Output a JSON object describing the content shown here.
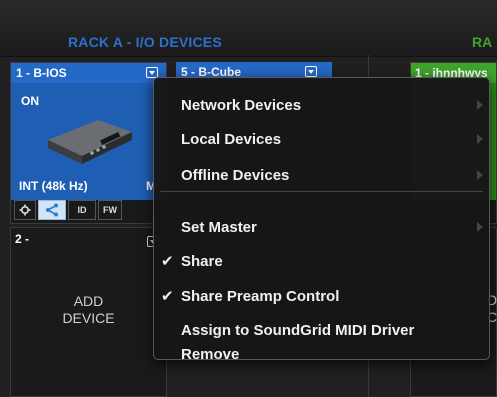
{
  "rack_a": {
    "title": "RACK A - I/O DEVICES",
    "slot1": {
      "name": "1 - B-IOS",
      "state": "ON",
      "rate": "INT (48k Hz)",
      "extra": "M",
      "buttons": [
        "ID",
        "FW"
      ]
    },
    "slot2": {
      "number": "2 -",
      "add_label_line1": "ADD",
      "add_label_line2": "DEVICE"
    },
    "slot5": {
      "name": "5 - B-Cube"
    }
  },
  "rack_b": {
    "title": "RA",
    "slot1": {
      "name": "1 - ihnnhwys"
    },
    "slot2": {
      "add_label_line1": "D",
      "add_label_line2": "CE"
    }
  },
  "menu": {
    "items": [
      {
        "label": "Network Devices",
        "checked": false,
        "submenu": true
      },
      {
        "label": "Local Devices",
        "checked": false,
        "submenu": true
      },
      {
        "label": "Offline Devices",
        "checked": false,
        "submenu": true
      },
      {
        "label": "Set Master",
        "checked": false,
        "submenu": true
      },
      {
        "label": "Share",
        "checked": true,
        "submenu": false
      },
      {
        "label": "Share Preamp Control",
        "checked": true,
        "submenu": false
      },
      {
        "label": "Assign to SoundGrid MIDI Driver",
        "checked": false,
        "submenu": false
      },
      {
        "label": "Remove",
        "checked": false,
        "submenu": false
      }
    ],
    "checkmark": "✔"
  },
  "colors": {
    "rack_a_accent": "#2569c7",
    "rack_b_accent": "#3ea52b",
    "menu_bg": "#161616"
  },
  "icons": [
    "gear-icon",
    "share-icon",
    "dropdown-arrow-icon",
    "submenu-arrow-icon",
    "checkmark-icon"
  ]
}
